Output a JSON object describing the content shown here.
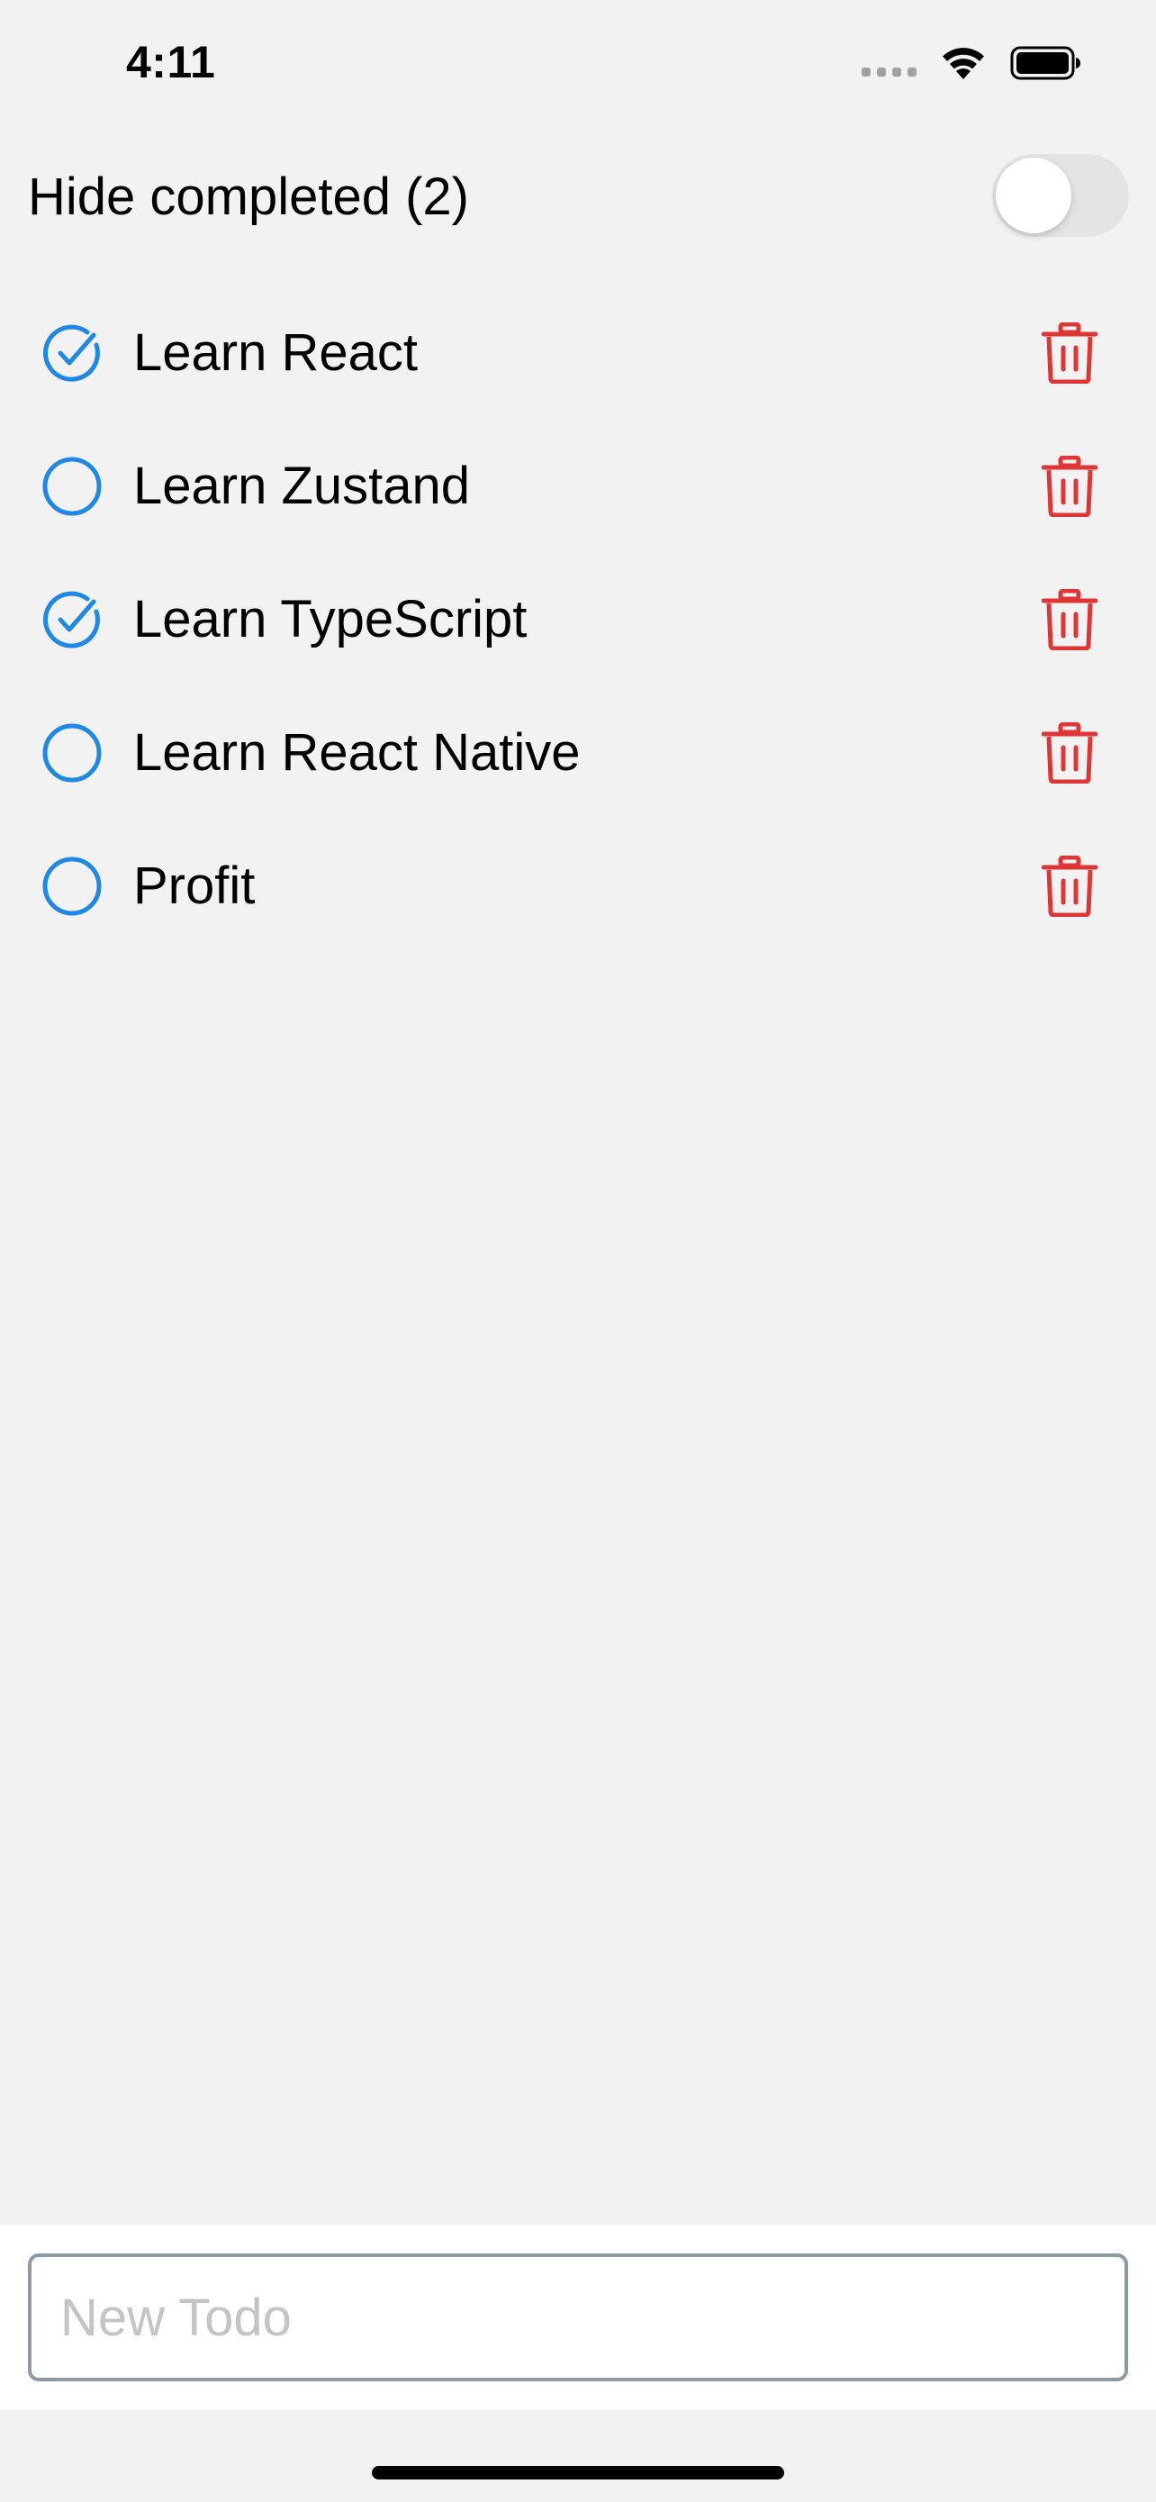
{
  "status_bar": {
    "time": "4:11",
    "signal_icon": "signal-dots-icon",
    "wifi_icon": "wifi-icon",
    "battery_icon": "battery-icon"
  },
  "header": {
    "hide_completed_label": "Hide completed (2)",
    "toggle_on": false
  },
  "colors": {
    "accent": "#1e88e5",
    "delete": "#e03535",
    "background": "#f2f2f2"
  },
  "todos": [
    {
      "text": "Learn React",
      "done": true
    },
    {
      "text": "Learn Zustand",
      "done": false
    },
    {
      "text": "Learn TypeScript",
      "done": true
    },
    {
      "text": "Learn React Native",
      "done": false
    },
    {
      "text": "Profit",
      "done": false
    }
  ],
  "input": {
    "placeholder": "New Todo",
    "value": ""
  }
}
